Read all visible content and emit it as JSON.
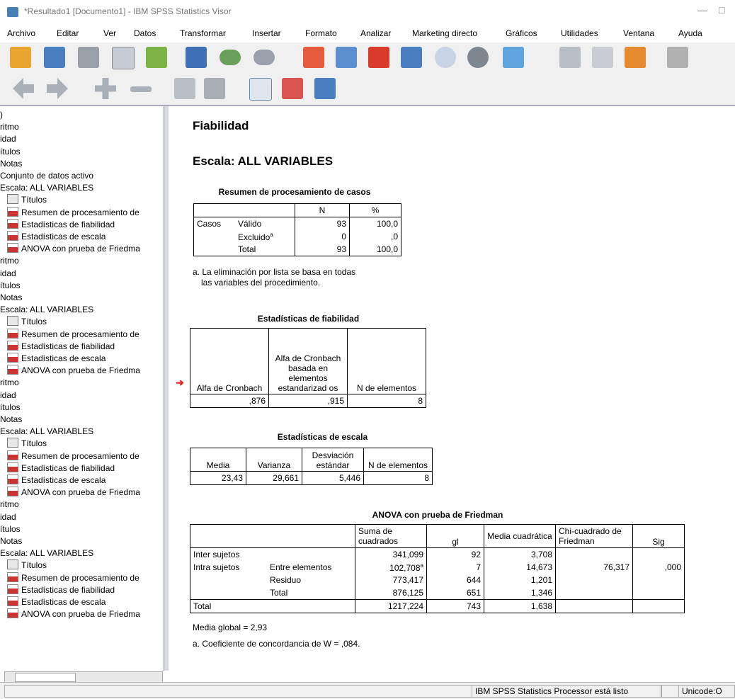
{
  "window": {
    "title": "*Resultado1 [Documento1] - IBM SPSS Statistics Visor",
    "minimize": "—",
    "maximize": "□"
  },
  "menu": [
    "Archivo",
    "Editar",
    "Ver",
    "Datos",
    "Transformar",
    "Insertar",
    "Formato",
    "Analizar",
    "Marketing directo",
    "Gráficos",
    "Utilidades",
    "Ventana",
    "Ayuda"
  ],
  "toolbar_icons": [
    "open-icon",
    "save-icon",
    "print-icon",
    "print-preview-icon",
    "export-icon",
    "dialog-recall-icon",
    "undo-icon",
    "redo-icon",
    "goto-data-icon",
    "goto-case-icon",
    "variables-icon",
    "select-cases-icon",
    "value-labels-icon",
    "use-sets-icon",
    "show-all-variables-icon",
    "spelling-icon",
    "insert-output-icon",
    "designate-window-icon"
  ],
  "toolbar2_icons": [
    "back-icon",
    "forward-icon",
    "expand-icon",
    "collapse-icon",
    "show-icon",
    "hide-icon",
    "insert-heading-icon",
    "insert-title-icon",
    "insert-text-icon"
  ],
  "outline": [
    {
      "text": ")",
      "icon": ""
    },
    {
      "text": "ritmo",
      "icon": ""
    },
    {
      "text": "idad",
      "icon": ""
    },
    {
      "text": "ítulos",
      "icon": ""
    },
    {
      "text": "Notas",
      "icon": ""
    },
    {
      "text": "Conjunto de datos activo",
      "icon": ""
    },
    {
      "text": "Escala: ALL VARIABLES",
      "icon": ""
    },
    {
      "text": "Títulos",
      "icon": "title"
    },
    {
      "text": "Resumen de procesamiento de",
      "icon": "table"
    },
    {
      "text": "Estadísticas de fiabilidad",
      "icon": "table"
    },
    {
      "text": "Estadísticas de escala",
      "icon": "table"
    },
    {
      "text": "ANOVA con prueba de Friedma",
      "icon": "table"
    },
    {
      "text": "ritmo",
      "icon": ""
    },
    {
      "text": "idad",
      "icon": ""
    },
    {
      "text": "ítulos",
      "icon": ""
    },
    {
      "text": "Notas",
      "icon": ""
    },
    {
      "text": "Escala: ALL VARIABLES",
      "icon": ""
    },
    {
      "text": "Títulos",
      "icon": "title"
    },
    {
      "text": "Resumen de procesamiento de",
      "icon": "table"
    },
    {
      "text": "Estadísticas de fiabilidad",
      "icon": "table"
    },
    {
      "text": "Estadísticas de escala",
      "icon": "table"
    },
    {
      "text": "ANOVA con prueba de Friedma",
      "icon": "table"
    },
    {
      "text": "ritmo",
      "icon": ""
    },
    {
      "text": "idad",
      "icon": ""
    },
    {
      "text": "ítulos",
      "icon": ""
    },
    {
      "text": "Notas",
      "icon": ""
    },
    {
      "text": "Escala: ALL VARIABLES",
      "icon": ""
    },
    {
      "text": "Títulos",
      "icon": "title"
    },
    {
      "text": "Resumen de procesamiento de",
      "icon": "table"
    },
    {
      "text": "Estadísticas de fiabilidad",
      "icon": "table"
    },
    {
      "text": "Estadísticas de escala",
      "icon": "table"
    },
    {
      "text": "ANOVA con prueba de Friedma",
      "icon": "table"
    },
    {
      "text": "ritmo",
      "icon": ""
    },
    {
      "text": "idad",
      "icon": ""
    },
    {
      "text": "ítulos",
      "icon": ""
    },
    {
      "text": "Notas",
      "icon": ""
    },
    {
      "text": "Escala: ALL VARIABLES",
      "icon": ""
    },
    {
      "text": "Títulos",
      "icon": "title"
    },
    {
      "text": "Resumen de procesamiento de",
      "icon": "table"
    },
    {
      "text": "Estadísticas de fiabilidad",
      "icon": "table"
    },
    {
      "text": "Estadísticas de escala",
      "icon": "table"
    },
    {
      "text": "ANOVA con prueba de Friedma",
      "icon": "table"
    }
  ],
  "output": {
    "heading": "Fiabilidad",
    "subheading": "Escala: ALL VARIABLES",
    "case_summary": {
      "caption": "Resumen de procesamiento de casos",
      "col_n": "N",
      "col_pct": "%",
      "group": "Casos",
      "rows": [
        {
          "label": "Válido",
          "sup": "",
          "n": "93",
          "pct": "100,0"
        },
        {
          "label": "Excluido",
          "sup": "a",
          "n": "0",
          "pct": ",0"
        },
        {
          "label": "Total",
          "sup": "",
          "n": "93",
          "pct": "100,0"
        }
      ],
      "footnote_1": "a. La eliminación por lista se basa en todas",
      "footnote_2": "las variables del procedimiento."
    },
    "reliability": {
      "caption": "Estadísticas de fiabilidad",
      "col1": "Alfa de Cronbach",
      "col2": "Alfa de Cronbach basada en elementos estandarizad os",
      "col3": "N de elementos",
      "v1": ",876",
      "v2": ",915",
      "v3": "8"
    },
    "scale": {
      "caption": "Estadísticas de escala",
      "col1": "Media",
      "col2": "Varianza",
      "col3": "Desviación estándar",
      "col4": "N de elementos",
      "v1": "23,43",
      "v2": "29,661",
      "v3": "5,446",
      "v4": "8"
    },
    "anova": {
      "caption": "ANOVA con prueba de Friedman",
      "headers": [
        "Suma de cuadrados",
        "gl",
        "Media cuadrática",
        "Chi-cuadrado de Friedman",
        "Sig"
      ],
      "rows": [
        {
          "c1": "Inter sujetos",
          "c2": "",
          "ss": "341,099",
          "sup": "",
          "gl": "92",
          "ms": "3,708",
          "chi": "",
          "sig": ""
        },
        {
          "c1": "Intra sujetos",
          "c2": "Entre elementos",
          "ss": "102,708",
          "sup": "a",
          "gl": "7",
          "ms": "14,673",
          "chi": "76,317",
          "sig": ",000"
        },
        {
          "c1": "",
          "c2": "Residuo",
          "ss": "773,417",
          "sup": "",
          "gl": "644",
          "ms": "1,201",
          "chi": "",
          "sig": ""
        },
        {
          "c1": "",
          "c2": "Total",
          "ss": "876,125",
          "sup": "",
          "gl": "651",
          "ms": "1,346",
          "chi": "",
          "sig": ""
        },
        {
          "c1": "Total",
          "c2": "",
          "ss": "1217,224",
          "sup": "",
          "gl": "743",
          "ms": "1,638",
          "chi": "",
          "sig": ""
        }
      ],
      "footnote_mean": "Media global = 2,93",
      "footnote_a": "a. Coeficiente de concordancia de W = ,084."
    }
  },
  "status": {
    "processor": "IBM SPSS Statistics Processor está listo",
    "unicode": "Unicode:O"
  }
}
